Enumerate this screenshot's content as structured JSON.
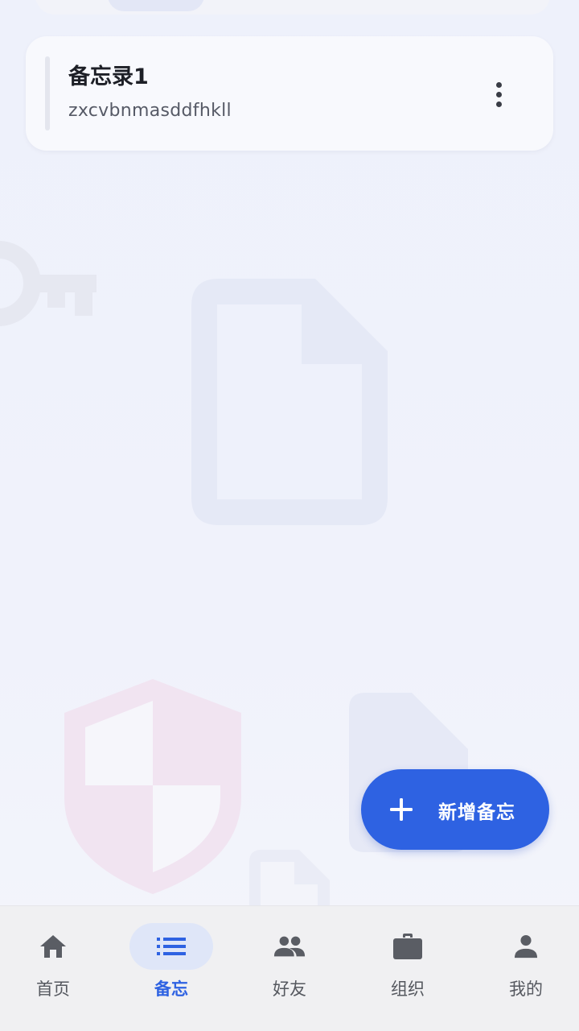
{
  "memo_card": {
    "title": "备忘录1",
    "content": "zxcvbnmasddfhkll"
  },
  "fab": {
    "label": "新增备忘"
  },
  "bottom_nav": {
    "items": [
      {
        "label": "首页",
        "icon": "home-icon",
        "active": false
      },
      {
        "label": "备忘",
        "icon": "list-icon",
        "active": true
      },
      {
        "label": "好友",
        "icon": "people-icon",
        "active": false
      },
      {
        "label": "组织",
        "icon": "briefcase-icon",
        "active": false
      },
      {
        "label": "我的",
        "icon": "person-icon",
        "active": false
      }
    ]
  },
  "colors": {
    "accent": "#2e62e2",
    "background": "#eef1fb",
    "nav_background": "#f0f0f2",
    "nav_active_pill": "#dfe6f8"
  }
}
